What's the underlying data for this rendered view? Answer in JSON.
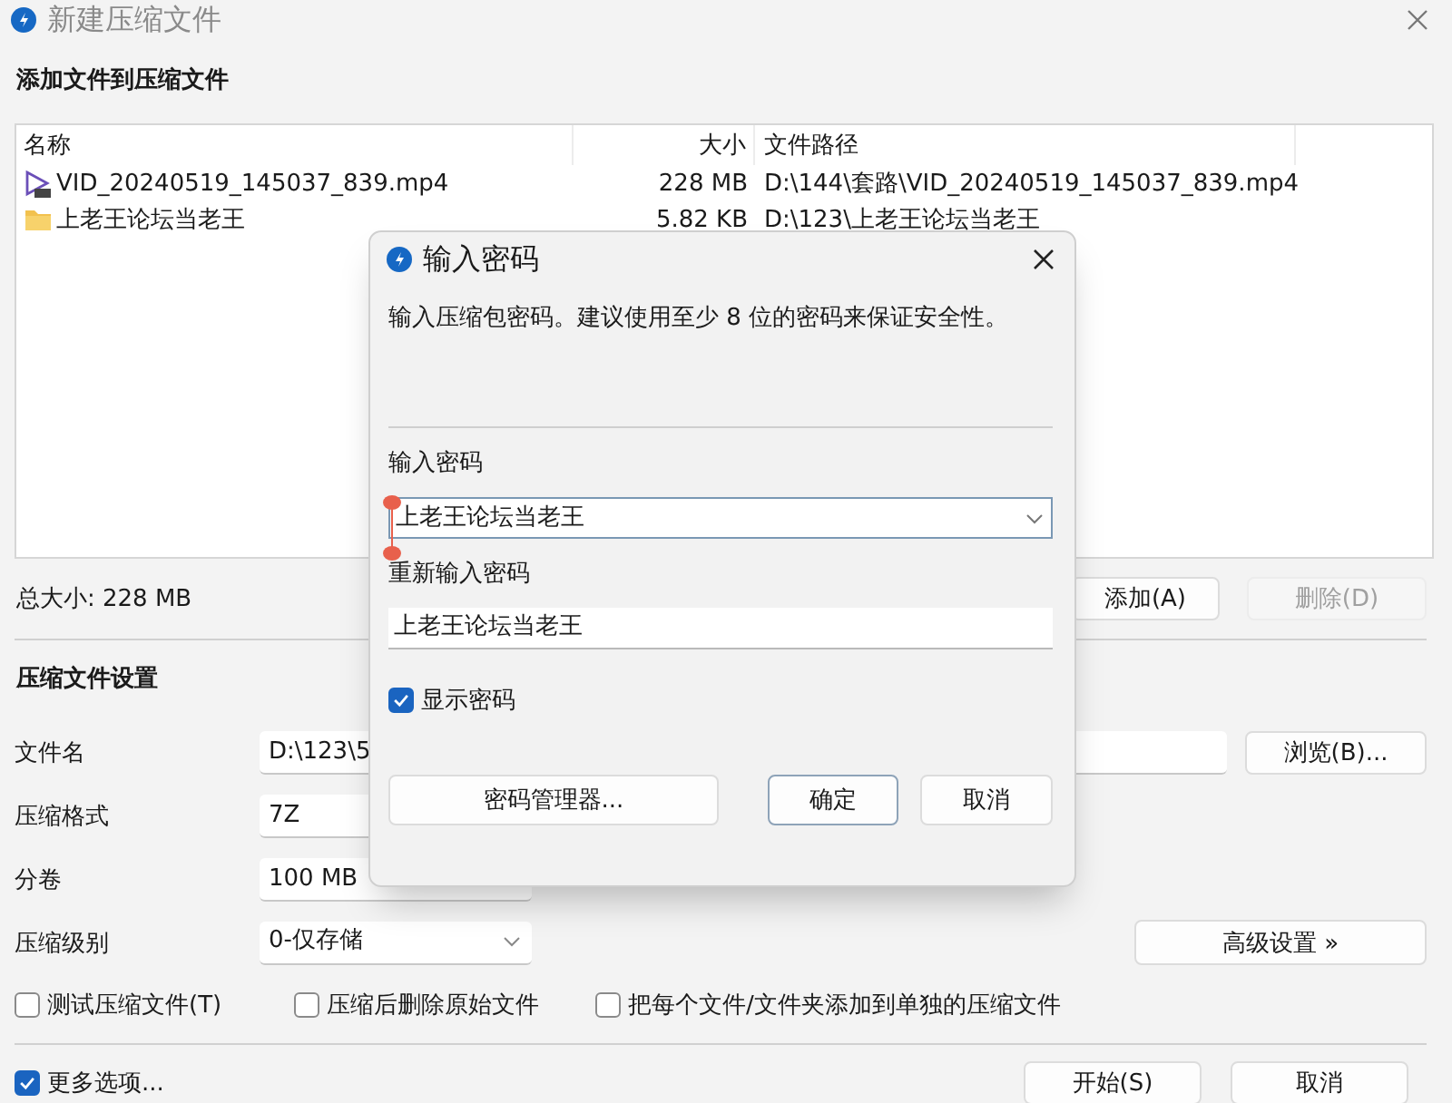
{
  "window": {
    "title": "新建压缩文件"
  },
  "add_section": {
    "title": "添加文件到压缩文件",
    "columns": [
      "名称",
      "大小",
      "文件路径"
    ],
    "rows": [
      {
        "kind": "video",
        "name": "VID_20240519_145037_839.mp4",
        "size": "228 MB",
        "path": "D:\\144\\套路\\VID_20240519_145037_839.mp4"
      },
      {
        "kind": "folder",
        "name": "上老王论坛当老王",
        "size": "5.82 KB",
        "path": "D:\\123\\上老王论坛当老王"
      }
    ],
    "total": "总大小: 228 MB",
    "buttons": [
      {
        "label": "添加(A)",
        "disabled": false
      },
      {
        "label": "删除(D)",
        "disabled": true
      }
    ]
  },
  "settings": {
    "title": "压缩文件设置",
    "fields": [
      {
        "kind": "text",
        "label": "文件名",
        "value": "D:\\123\\5"
      },
      {
        "kind": "text",
        "label": "压缩格式",
        "value": "7Z"
      },
      {
        "kind": "text",
        "label": "分卷",
        "value": "100 MB"
      },
      {
        "kind": "dropdown",
        "label": "压缩级别",
        "value": "0-仅存储"
      }
    ],
    "browse_button": "浏览(B)...",
    "advanced_button": "高级设置 »",
    "options": [
      {
        "label": "测试压缩文件(T)",
        "checked": false
      },
      {
        "label": "压缩后删除原始文件",
        "checked": false
      },
      {
        "label": "把每个文件/文件夹添加到单独的压缩文件",
        "checked": false
      }
    ]
  },
  "footer": {
    "more_options": {
      "label": "更多选项...",
      "checked": true
    },
    "buttons": [
      "开始(S)",
      "取消"
    ]
  },
  "dialog": {
    "title": "输入密码",
    "description": "输入压缩包密码。建议使用至少 8 位的密码来保证安全性。",
    "password_label": "输入密码",
    "password_value": "上老王论坛当老王",
    "confirm_label": "重新输入密码",
    "confirm_value": "上老王论坛当老王",
    "show_password": {
      "label": "显示密码",
      "checked": true
    },
    "buttons": [
      {
        "label": "密码管理器...",
        "default": false
      },
      {
        "label": "确定",
        "default": true
      },
      {
        "label": "取消",
        "default": false
      }
    ]
  }
}
